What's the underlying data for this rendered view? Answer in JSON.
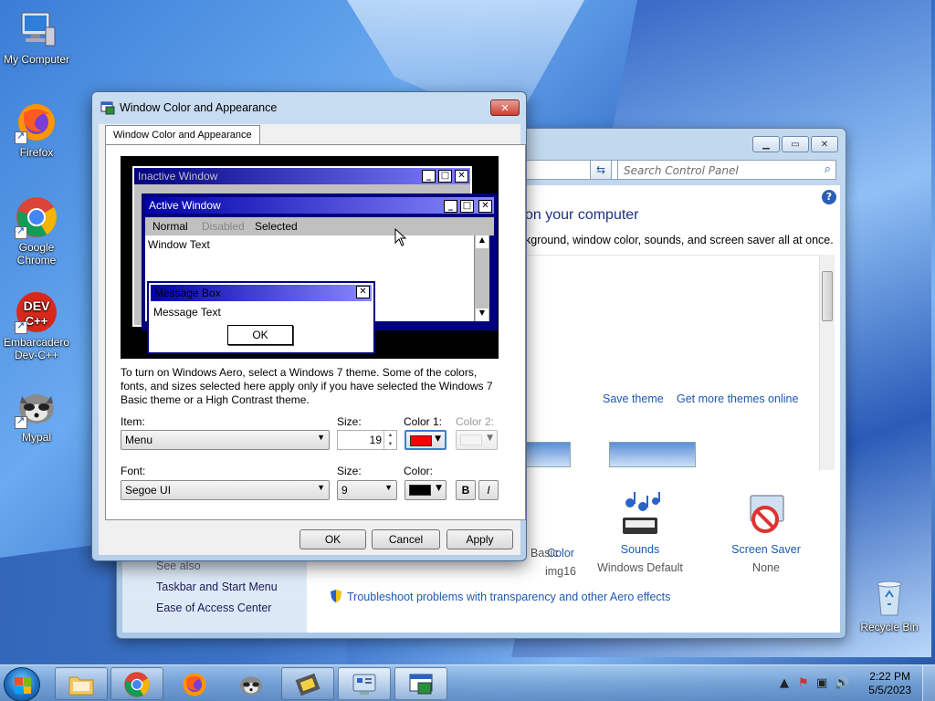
{
  "desktop": {
    "icons": [
      {
        "label": "My Computer",
        "icon": "computer-icon"
      },
      {
        "label": "Firefox",
        "icon": "firefox-icon"
      },
      {
        "label": "Google Chrome",
        "icon": "chrome-icon"
      },
      {
        "label": "Embarcadero Dev-C++",
        "icon": "devcpp-icon"
      },
      {
        "label": "Mypal",
        "icon": "mypal-icon"
      },
      {
        "label": "Recycle Bin",
        "icon": "recycle-bin-icon"
      }
    ]
  },
  "control_panel": {
    "search_placeholder": "Search Control Panel",
    "heading": "on your computer",
    "subheading": "kground, window color, sounds, and screen saver all at once.",
    "save_theme": "Save theme",
    "get_more_themes": "Get more themes online",
    "items": [
      {
        "label": "Color",
        "value": "img16"
      },
      {
        "label": "",
        "value": "Windows 7 Basic"
      },
      {
        "label": "Sounds",
        "value": "Windows Default"
      },
      {
        "label": "Screen Saver",
        "value": "None"
      }
    ],
    "see_also": "See also",
    "left_links": [
      "Taskbar and Start Menu",
      "Ease of Access Center"
    ],
    "troubleshoot": "Troubleshoot problems with transparency and other Aero effects"
  },
  "dialog": {
    "title": "Window Color and Appearance",
    "tab": "Window Color and Appearance",
    "preview": {
      "inactive_window": "Inactive Window",
      "active_window": "Active Window",
      "menu": [
        "Normal",
        "Disabled",
        "Selected"
      ],
      "window_text": "Window Text",
      "message_box": "Message Box",
      "message_text": "Message Text",
      "ok": "OK"
    },
    "instructions": "To turn on Windows Aero, select a Windows 7 theme.  Some of the colors, fonts, and sizes selected here apply only if you have selected the Windows 7 Basic theme or a High Contrast theme.",
    "item_label": "Item:",
    "item_value": "Menu",
    "size_label": "Size:",
    "item_size": "19",
    "color1_label": "Color 1:",
    "color1": "#ff0000",
    "color2_label": "Color 2:",
    "font_label": "Font:",
    "font_value": "Segoe UI",
    "font_size_label": "Size:",
    "font_size": "9",
    "font_color_label": "Color:",
    "font_color": "#000000",
    "bold": "B",
    "italic": "I",
    "buttons": {
      "ok": "OK",
      "cancel": "Cancel",
      "apply": "Apply"
    }
  },
  "taskbar": {
    "time": "2:22 PM",
    "date": "5/5/2023"
  }
}
